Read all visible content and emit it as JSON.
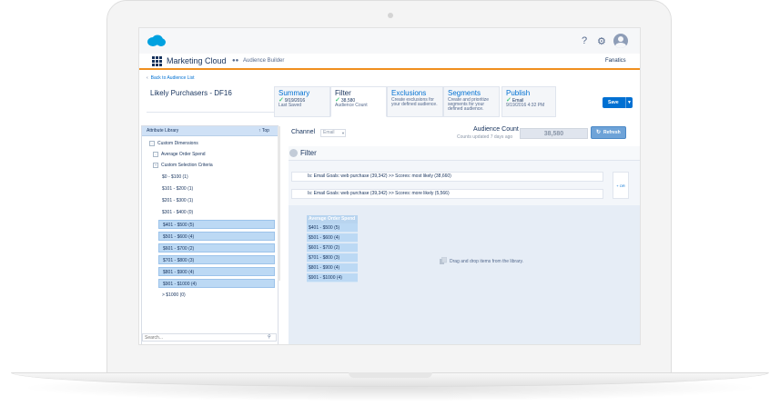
{
  "header": {
    "app_name": "Marketing Cloud",
    "builder_name": "Audience Builder",
    "org_name": "Fanatics",
    "help_icon": "?",
    "settings_icon": "⚙"
  },
  "nav": {
    "back_label": "Back to Audience List"
  },
  "audience": {
    "name": "Likely Purchasers - DF16"
  },
  "steps": [
    {
      "title": "Summary",
      "detail": "9/19/2016",
      "sub": "Last Saved"
    },
    {
      "title": "Filter",
      "detail": "38,580",
      "sub": "Audience Count"
    },
    {
      "title": "Exclusions",
      "detail": "",
      "sub": "Create exclusions for your defined audience."
    },
    {
      "title": "Segments",
      "detail": "",
      "sub": "Create and prioritize segments for your defined audience."
    },
    {
      "title": "Publish",
      "detail": "Email",
      "sub": "9/19/2016 4:32 PM"
    }
  ],
  "toolbar": {
    "save_label": "Save"
  },
  "library": {
    "title": "Attribute Library",
    "top_label": "Top",
    "tree": [
      {
        "label": "Custom Dimensions",
        "toggle": "-"
      },
      {
        "label": "Average Order Spend",
        "toggle": "-"
      },
      {
        "label": "Custom Selection Criteria",
        "toggle": "+"
      }
    ],
    "ranges": [
      {
        "label": "$0 - $100 (1)",
        "selected": false
      },
      {
        "label": "$101 - $200 (1)",
        "selected": false
      },
      {
        "label": "$201 - $300 (1)",
        "selected": false
      },
      {
        "label": "$301 - $400 (0)",
        "selected": false
      },
      {
        "label": "$401 - $500 (5)",
        "selected": true
      },
      {
        "label": "$501 - $600 (4)",
        "selected": true
      },
      {
        "label": "$601 - $700 (2)",
        "selected": true
      },
      {
        "label": "$701 - $800 (3)",
        "selected": true
      },
      {
        "label": "$801 - $900 (4)",
        "selected": true
      },
      {
        "label": "$901 - $1000 (4)",
        "selected": true
      },
      {
        "label": "> $1000 (0)",
        "selected": false
      }
    ],
    "search_placeholder": "Search..."
  },
  "filter_panel": {
    "channel_label": "Channel",
    "channel_value": "Email",
    "audience_count_label": "Audience Count",
    "counts_updated": "Counts updated 7 days ago",
    "audience_count": "38,580",
    "refresh_label": "Refresh",
    "filter_title": "Filter",
    "conditions": [
      "Is: Email Goals: web purchase (39,342) >> Scores: most likely (38,660)",
      "Is: Email Goals: web purchase (39,342) >> Scores: more likely (5,566)"
    ],
    "or_label": "+ OR",
    "aos_title": "Average Order Spend",
    "aos_items": [
      "$401 - $500 (5)",
      "$501 - $600 (4)",
      "$601 - $700 (2)",
      "$701 - $800 (3)",
      "$801 - $900 (4)",
      "$901 - $1000 (4)"
    ],
    "drop_hint": "Drag and drop items from the library."
  },
  "colors": {
    "accent_orange": "#f08f1e",
    "brand_blue": "#0070d2",
    "selection_blue": "#bcd9f4"
  }
}
